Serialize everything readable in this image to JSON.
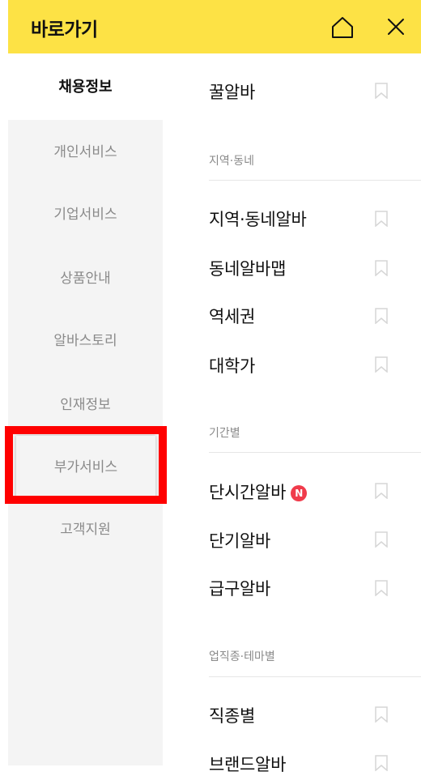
{
  "header": {
    "title": "바로가기"
  },
  "categories": [
    {
      "label": "채용정보",
      "active": true
    },
    {
      "label": "개인서비스"
    },
    {
      "label": "기업서비스"
    },
    {
      "label": "상품안내"
    },
    {
      "label": "알바스토리"
    },
    {
      "label": "인재정보"
    },
    {
      "label": "부가서비스",
      "highlighted": true
    },
    {
      "label": "고객지원"
    }
  ],
  "menu": {
    "top_item": "꿀알바",
    "sections": [
      {
        "title": "지역·동네",
        "items": [
          "지역·동네알바",
          "동네알바맵",
          "역세권",
          "대학가"
        ]
      },
      {
        "title": "기간별",
        "items": [
          "단시간알바",
          "단기알바",
          "급구알바"
        ],
        "badge_item": "단시간알바",
        "badge": "N"
      },
      {
        "title": "업직종·테마별",
        "items": [
          "직종별",
          "브랜드알바"
        ]
      }
    ]
  },
  "colors": {
    "header_bg": "#fde245",
    "badge": "#f03b4b",
    "highlight_border": "#ff0000"
  }
}
